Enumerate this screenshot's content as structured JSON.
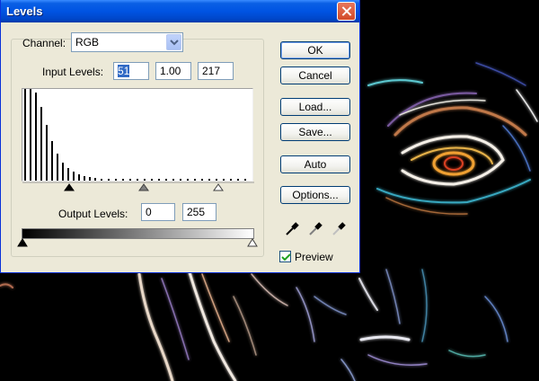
{
  "window": {
    "title": "Levels"
  },
  "channel": {
    "label": "Channel:",
    "value": "RGB"
  },
  "input_levels": {
    "label": "Input Levels:",
    "black": "51",
    "gamma": "1.00",
    "white": "217"
  },
  "output_levels": {
    "label": "Output Levels:",
    "black": "0",
    "white": "255"
  },
  "buttons": {
    "ok": "OK",
    "cancel": "Cancel",
    "load": "Load...",
    "save": "Save...",
    "auto": "Auto",
    "options": "Options..."
  },
  "preview": {
    "label": "Preview",
    "checked": true
  },
  "icons": {
    "close": "close-icon",
    "dropdown": "chevron-down-icon",
    "black_eyedropper": "eyedropper-black-icon",
    "gray_eyedropper": "eyedropper-gray-icon",
    "white_eyedropper": "eyedropper-white-icon"
  },
  "colors": {
    "titlebar": "#0054e3",
    "dialog_bg": "#ece9d8",
    "selection": "#316ac5"
  }
}
